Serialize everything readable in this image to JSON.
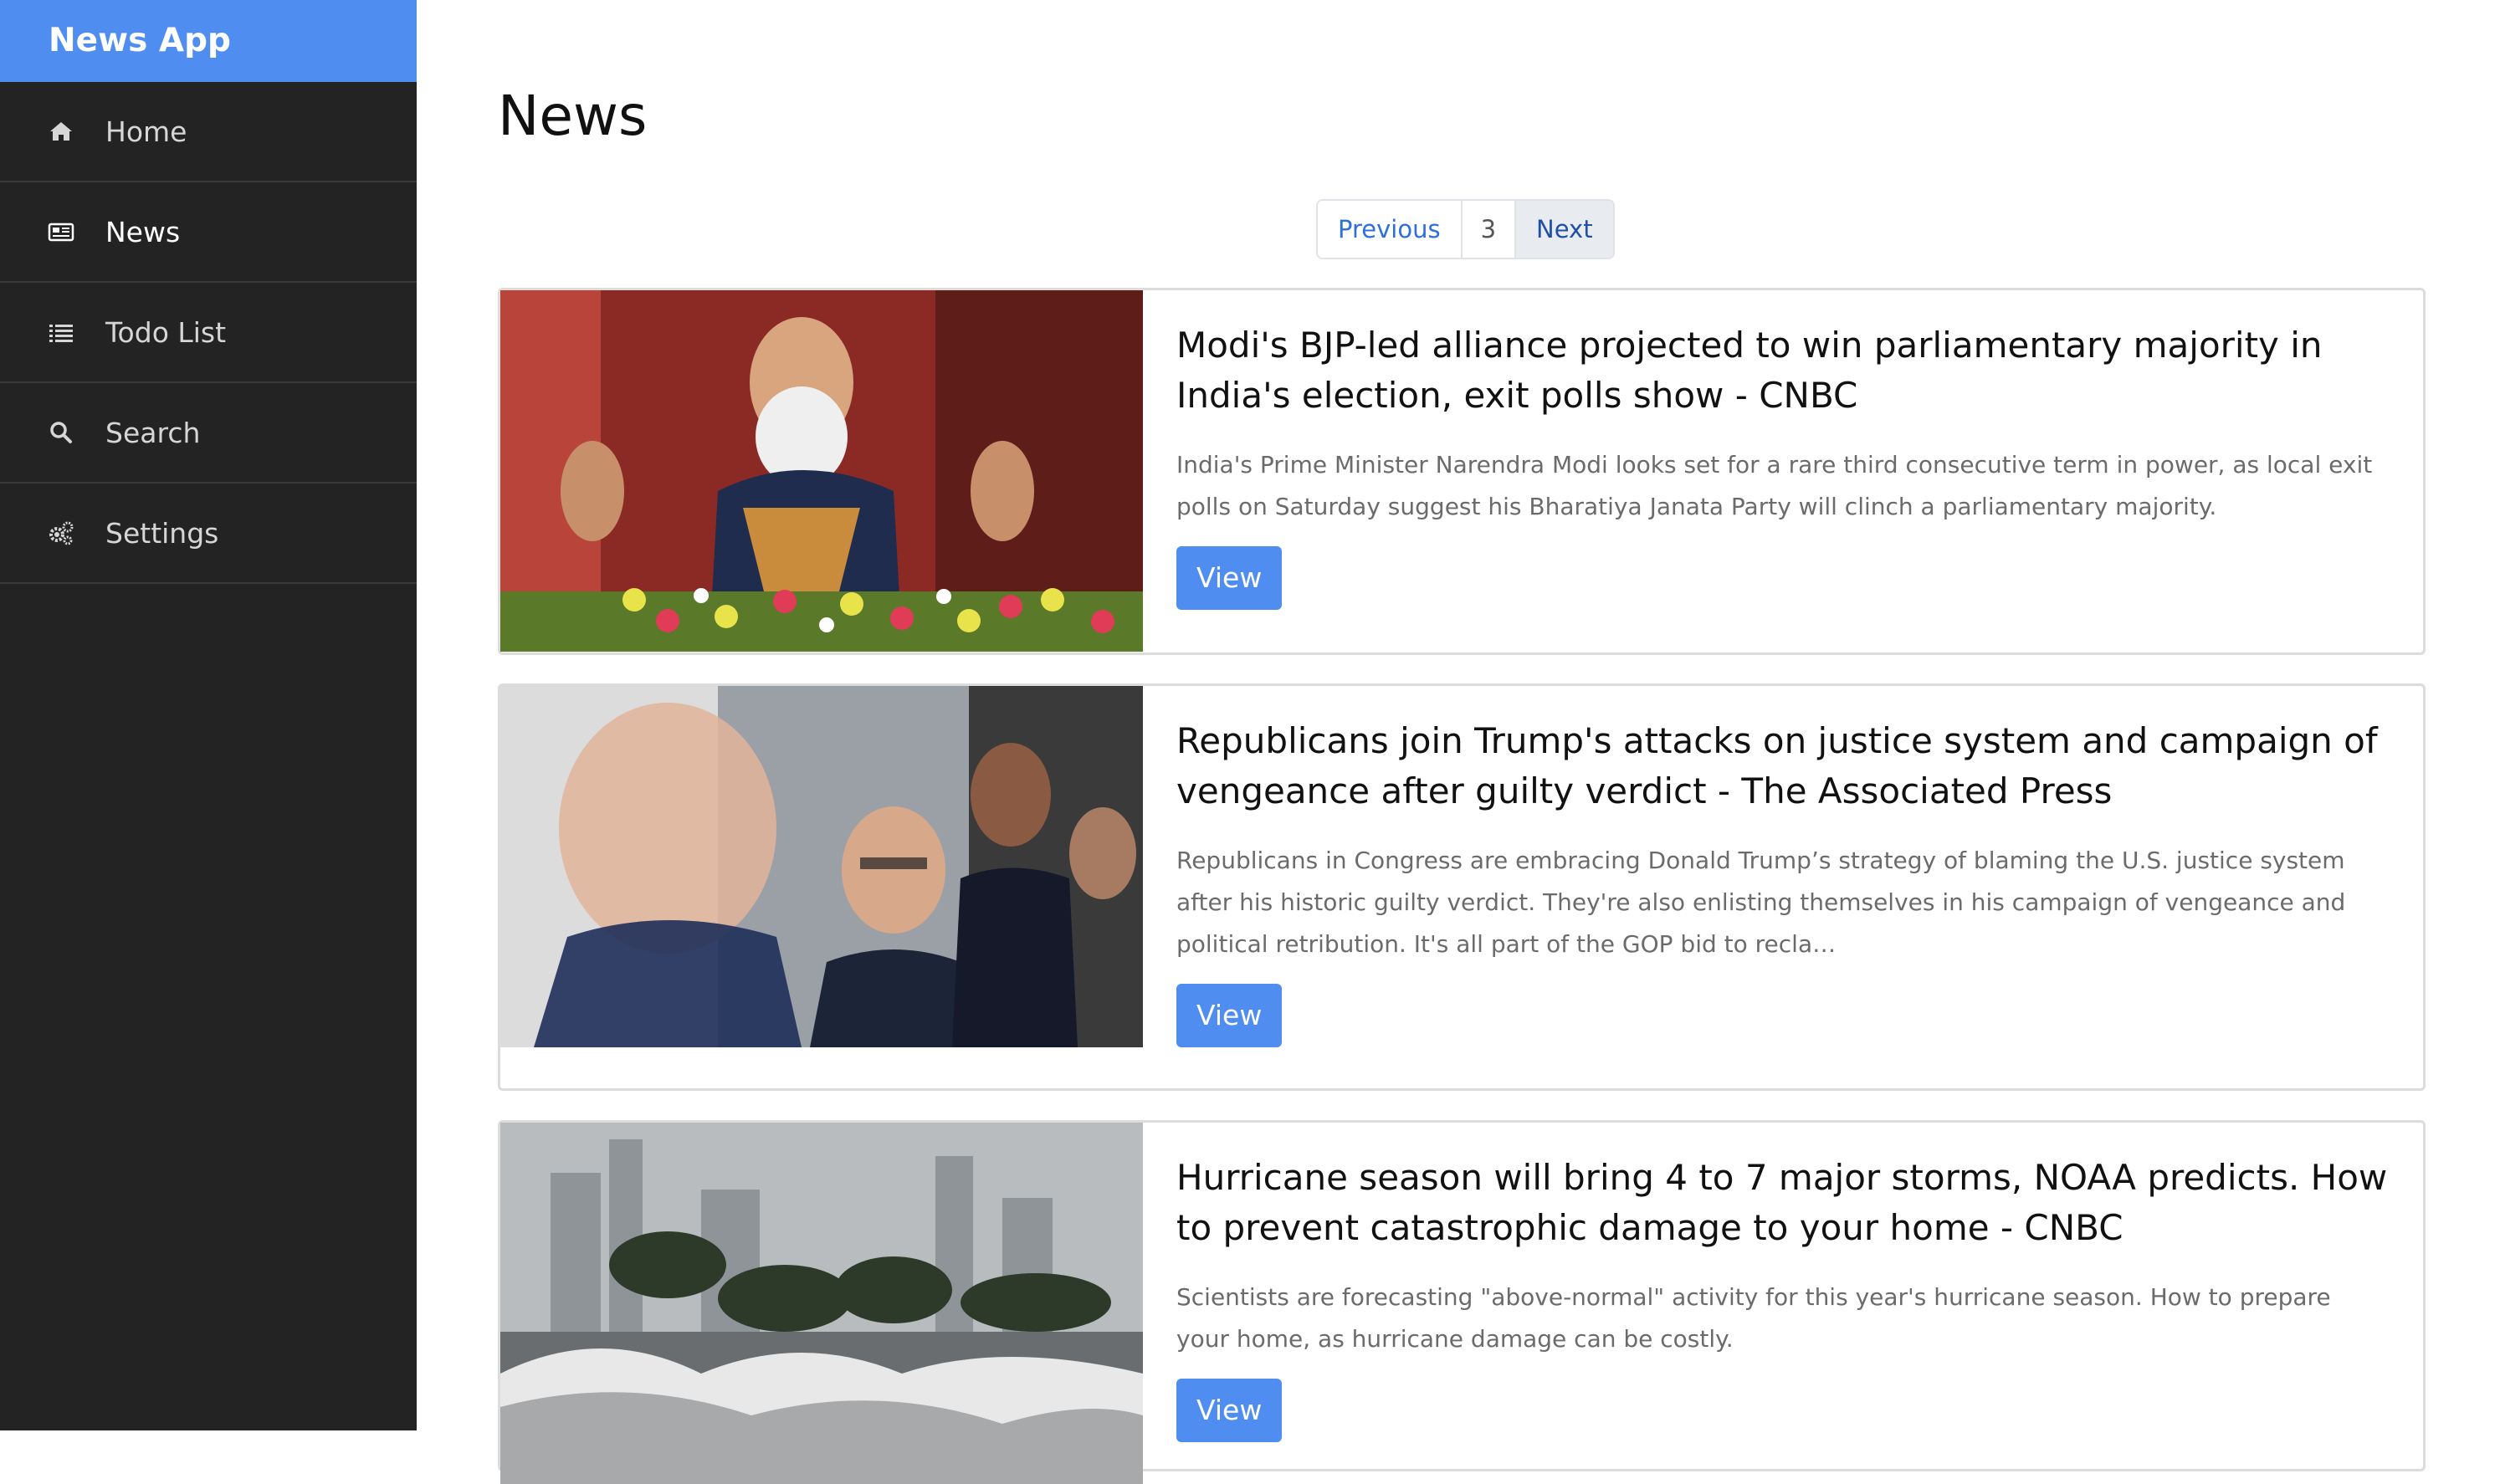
{
  "app": {
    "brand": "News App",
    "accent": "#4f8ef0",
    "sidebar_bg": "#232323"
  },
  "sidebar": {
    "items": [
      {
        "label": "Home",
        "icon": "home-icon"
      },
      {
        "label": "News",
        "icon": "newspaper-icon"
      },
      {
        "label": "Todo List",
        "icon": "list-icon"
      },
      {
        "label": "Search",
        "icon": "search-icon"
      },
      {
        "label": "Settings",
        "icon": "gears-icon"
      }
    ],
    "active": "News"
  },
  "main": {
    "title": "News",
    "pagination": {
      "previous": "Previous",
      "current_page": "3",
      "next": "Next"
    },
    "articles": [
      {
        "title": "Modi's BJP-led alliance projected to win parliamentary majority in India's election, exit polls show - CNBC",
        "description": "India's Prime Minister Narendra Modi looks set for a rare third consecutive term in power, as local exit polls on Saturday suggest his Bharatiya Janata Party will clinch a parliamentary majority.",
        "button": "View"
      },
      {
        "title": "Republicans join Trump's attacks on justice system and campaign of vengeance after guilty verdict - The Associated Press",
        "description": "Republicans in Congress are embracing Donald Trump’s strategy of blaming the U.S. justice system after his historic guilty verdict. They're also enlisting themselves in his campaign of vengeance and political retribution. It's all part of the GOP bid to recla…",
        "button": "View"
      },
      {
        "title": "Hurricane season will bring 4 to 7 major storms, NOAA predicts. How to prevent catastrophic damage to your home - CNBC",
        "description": "Scientists are forecasting \"above-normal\" activity for this year's hurricane season. How to prepare your home, as hurricane damage can be costly.",
        "button": "View"
      }
    ]
  }
}
